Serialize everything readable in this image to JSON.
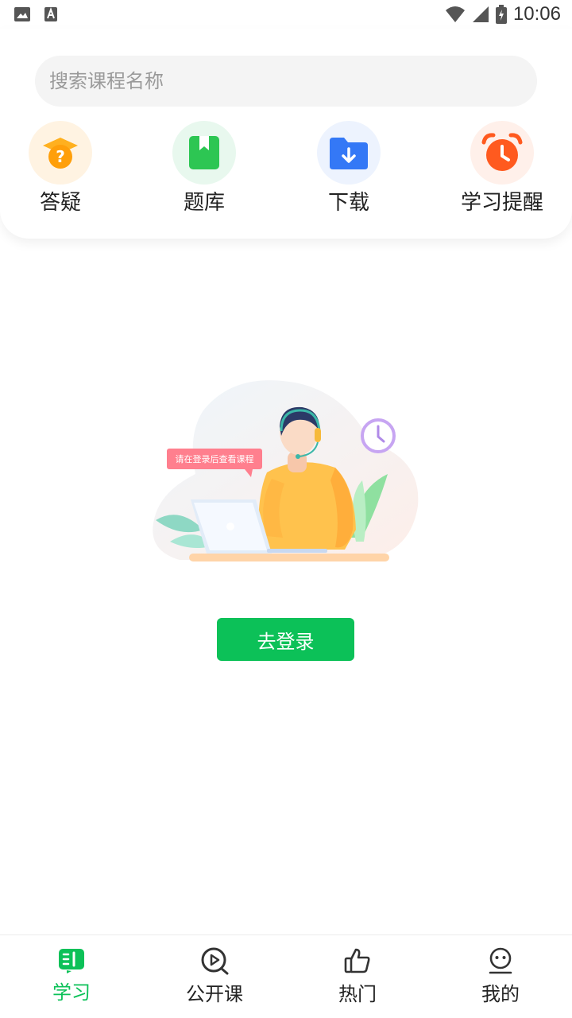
{
  "status_bar": {
    "time": "10:06"
  },
  "search": {
    "placeholder": "搜索课程名称"
  },
  "quick_actions": [
    {
      "label": "答疑",
      "icon": "qa-graduation-cap-icon",
      "color": "#ff9f0a"
    },
    {
      "label": "题库",
      "icon": "question-bank-book-icon",
      "color": "#2dc653"
    },
    {
      "label": "下载",
      "icon": "download-folder-icon",
      "color": "#3478f6"
    },
    {
      "label": "学习提醒",
      "icon": "alarm-clock-icon",
      "color": "#ff5a1f"
    }
  ],
  "empty_state": {
    "bubble_text": "请在登录后查看课程",
    "login_button": "去登录"
  },
  "tabbar": {
    "tabs": [
      {
        "label": "学习",
        "icon": "study-book-icon",
        "active": true
      },
      {
        "label": "公开课",
        "icon": "play-circle-icon",
        "active": false
      },
      {
        "label": "热门",
        "icon": "thumbs-up-icon",
        "active": false
      },
      {
        "label": "我的",
        "icon": "profile-face-icon",
        "active": false
      }
    ]
  },
  "colors": {
    "accent": "#0cc158",
    "search_bg": "#f4f4f4"
  }
}
